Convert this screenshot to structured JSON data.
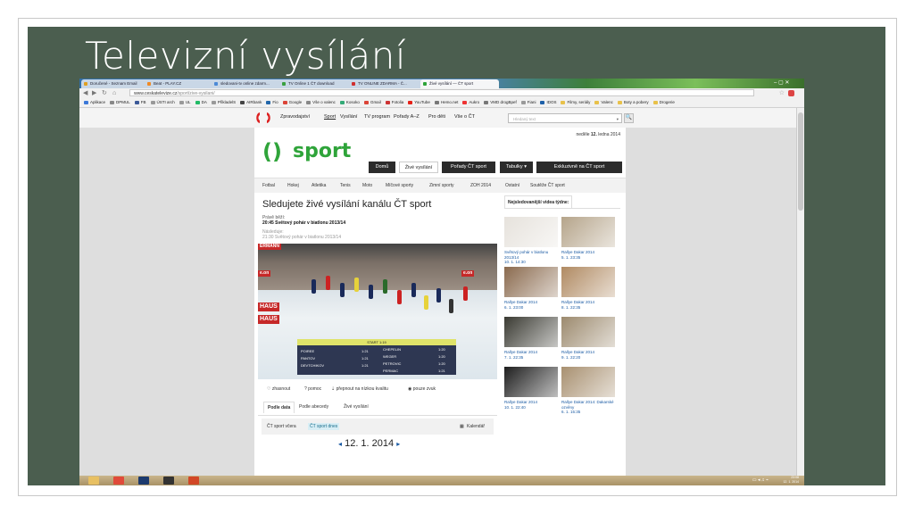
{
  "slide": {
    "title": "Televizní vysílání"
  },
  "browser": {
    "tabs": [
      {
        "label": "Doručené - Seznam Email",
        "color": "#e0a020"
      },
      {
        "label": "Beat - PLAY.CZ",
        "color": "#f08a24"
      },
      {
        "label": "sledovani-tv online zdarm...",
        "color": "#4c8ad6"
      },
      {
        "label": "TV Online 1 ČT download",
        "color": "#3aa040"
      },
      {
        "label": "TV ONLINE ZDARMA - Č...",
        "color": "#d03030"
      },
      {
        "label": "Živé vysílání — ČT sport",
        "color": "#2fa43a",
        "active": true
      }
    ],
    "url_host": "www.ceskatelevize.cz",
    "url_path": "/sport/zive-vysilani/",
    "bookmarks": [
      {
        "label": "Aplikace",
        "color": "#3c78d8"
      },
      {
        "label": "DPMUL",
        "color": "#888"
      },
      {
        "label": "FB",
        "color": "#3b5998"
      },
      {
        "label": "ÚSTI arch",
        "color": "#999"
      },
      {
        "label": "UL",
        "color": "#999"
      },
      {
        "label": "DA",
        "color": "#2b6"
      },
      {
        "label": "PřikladelS",
        "color": "#999"
      },
      {
        "label": "AIRbank",
        "color": "#444"
      },
      {
        "label": "Fio",
        "color": "#2266aa"
      },
      {
        "label": "Google",
        "color": "#db4437"
      },
      {
        "label": "Vše o valenc",
        "color": "#888"
      },
      {
        "label": "Kosoko",
        "color": "#3a7"
      },
      {
        "label": "Gmail",
        "color": "#db4437"
      },
      {
        "label": "Fotolia",
        "color": "#c33"
      },
      {
        "label": "YouTube",
        "color": "#e62117"
      },
      {
        "label": "Hemo.net",
        "color": "#777"
      },
      {
        "label": "Aukro",
        "color": "#e33"
      },
      {
        "label": "VMD drogBpef",
        "color": "#777"
      },
      {
        "label": "Fiani",
        "color": "#999"
      },
      {
        "label": "IDOS",
        "color": "#1e60a8"
      },
      {
        "label": "Filmy, seriály",
        "color": "#e8c14a"
      },
      {
        "label": "Valenc",
        "color": "#e8c14a"
      },
      {
        "label": "Boty a pobery",
        "color": "#e8c14a"
      },
      {
        "label": "Drogerie",
        "color": "#e8c14a"
      }
    ]
  },
  "site": {
    "topnav": [
      "Zpravodajství",
      "Sport",
      "Vysílání",
      "TV program",
      "Pořady A–Z",
      "Pro děti",
      "Vše o ČT"
    ],
    "search_placeholder": "Hledaný text",
    "search_button": "🔍",
    "date_prefix": "neděle",
    "date_day": "12.",
    "date_rest": "ledna 2014",
    "logo_word": "sport",
    "mainnav": [
      "Domů",
      "Živé vysílání",
      "Pořady ČT sport",
      "Tabulky ▾",
      "Exkluzivně na ČT sport"
    ],
    "subnav": [
      "Fotbal",
      "Hokej",
      "Atletika",
      "Tenis",
      "Moto",
      "Míčové sporty",
      "Zimní sporty",
      "ZOH 2014",
      "Ostatní",
      "Soutěže ČT sport"
    ],
    "heading": "Sledujete živé vysílání kanálu ČT sport",
    "now_label": "Právě běží:",
    "now_value": "20:45 Světový pohár v biatlonu 2013/14",
    "next_label": "Následuje:",
    "next_value": "21:30 Světový pohár v biatlonu 2013/14",
    "video": {
      "banner1": "ERMANN",
      "banner2": "e.on",
      "banner3": "HAUS",
      "banner4": "e.on",
      "score_title": "START",
      "score_time": "1:19",
      "rows_left": [
        {
          "name": "POIREE",
          "time": "1:21"
        },
        {
          "name": "PANTOV",
          "time": "1:21"
        },
        {
          "name": "DEVTCHIKOV",
          "time": "1:21"
        }
      ],
      "rows_right": [
        {
          "name": "CHEPELIN",
          "time": "1:20"
        },
        {
          "name": "WEGER",
          "time": "1:20"
        },
        {
          "name": "PETROVIC",
          "time": "1:20"
        },
        {
          "name": "PERMAC",
          "time": "1:21"
        }
      ]
    },
    "controls": [
      "♡ zhasnout",
      "? pomoc",
      "⇣ přepnout na nízkou kvalitu",
      "◉ pouze zvuk"
    ],
    "schedule_tabs": [
      "Podle data",
      "Podle abecedy",
      "Živé vysílání"
    ],
    "schedule_channels": [
      "ČT sport včera",
      "ČT sport dnes"
    ],
    "calendar_label": "Kalendář",
    "day_prev": "◂",
    "day": "12. 1. 2014",
    "day_next": "▸",
    "most_watched_title": "Nejsledovanější videa týdne:",
    "videos": [
      {
        "title": "Světový pohár v biatlonu 2013/14",
        "date": "10. 1. 14:30",
        "tint": "#e6e2dc"
      },
      {
        "title": "Rallye Dakar 2014",
        "date": "5. 1. 23:35",
        "tint": "#b5a48a"
      },
      {
        "title": "Rallye Dakar 2014",
        "date": "6. 1. 23:00",
        "tint": "#8a6a4e"
      },
      {
        "title": "Rallye Dakar 2014",
        "date": "8. 1. 22:35",
        "tint": "#b08a62"
      },
      {
        "title": "Rallye Dakar 2014",
        "date": "7. 1. 22:35",
        "tint": "#3a3a32"
      },
      {
        "title": "Rallye Dakar 2014",
        "date": "9. 1. 22:20",
        "tint": "#9c8a6e"
      },
      {
        "title": "Rallye Dakar 2014",
        "date": "10. 1. 22:40",
        "tint": "#1e1e1e"
      },
      {
        "title": "Rallye Dakar 2014: Dakarské ozvěny",
        "date": "6. 1. 15:35",
        "tint": "#a89070"
      }
    ]
  },
  "taskbar": {
    "icons": [
      {
        "name": "explorer",
        "color": "#e8c062"
      },
      {
        "name": "chrome",
        "color": "#e04a3a"
      },
      {
        "name": "photoshop",
        "color": "#1c3a6e"
      },
      {
        "name": "camera",
        "color": "#333"
      },
      {
        "name": "powerpoint",
        "color": "#d24726"
      }
    ],
    "time": "23:08",
    "date": "12. 1. 2014"
  }
}
